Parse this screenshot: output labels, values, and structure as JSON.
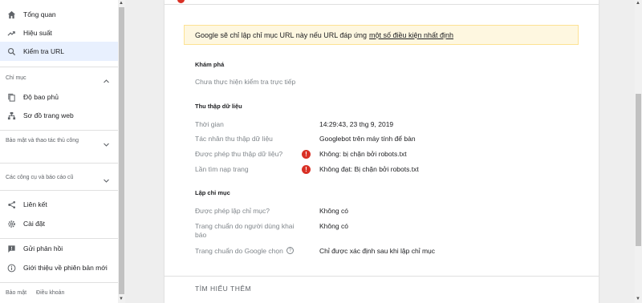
{
  "sidebar": {
    "items_top": [
      {
        "label": "Tổng quan",
        "icon": "home-icon"
      },
      {
        "label": "Hiệu suất",
        "icon": "trending-icon"
      },
      {
        "label": "Kiểm tra URL",
        "icon": "search-icon",
        "active": true
      }
    ],
    "section_index": "Chỉ mục",
    "items_index": [
      {
        "label": "Độ bao phủ",
        "icon": "file-copy-icon"
      },
      {
        "label": "Sơ đồ trang web",
        "icon": "sitemap-icon"
      }
    ],
    "section_security": "Bảo mật và thao tác thủ công",
    "section_tools": "Các công cụ và báo cáo cũ",
    "items_bottom": [
      {
        "label": "Liên kết",
        "icon": "links-icon"
      },
      {
        "label": "Cài đặt",
        "icon": "gear-icon"
      }
    ],
    "items_feedback": [
      {
        "label": "Gửi phản hồi",
        "icon": "feedback-icon"
      },
      {
        "label": "Giới thiệu về phiên bản mới",
        "icon": "info-icon"
      }
    ],
    "footer": {
      "privacy": "Bảo mật",
      "terms": "Điều khoản"
    }
  },
  "notice": {
    "text": "Google sẽ chỉ lập chỉ mục URL này nếu URL đáp ứng",
    "link": "một số điều kiện nhất định"
  },
  "discovery": {
    "title": "Khám phá",
    "status": "Chưa thực hiện kiểm tra trực tiếp"
  },
  "crawl": {
    "title": "Thu thập dữ liệu",
    "rows": [
      {
        "label": "Thời gian",
        "value": "14:29:43, 23 thg 9, 2019"
      },
      {
        "label": "Tác nhân thu thập dữ liệu",
        "value": "Googlebot trên máy tính để bàn"
      },
      {
        "label": "Được phép thu thập dữ liệu?",
        "value": "Không: bị chặn bởi robots.txt"
      },
      {
        "label": "Lần tìm nạp trang",
        "value": "Không đạt: Bị chặn bởi robots.txt"
      }
    ]
  },
  "indexing": {
    "title": "Lập chỉ mục",
    "rows": [
      {
        "label": "Được phép lập chỉ mục?",
        "value": "Không có"
      },
      {
        "label": "Trang chuẩn do người dùng khai báo",
        "value": "Không có"
      },
      {
        "label": "Trang chuẩn do Google chọn",
        "value": "Chỉ được xác định sau khi lập chỉ mục"
      }
    ]
  },
  "footer": {
    "learn_more": "TÌM HIỂU THÊM"
  },
  "colors": {
    "error": "#d93025",
    "notice_bg": "#fef7e0",
    "active_bg": "#e8f0fe"
  }
}
